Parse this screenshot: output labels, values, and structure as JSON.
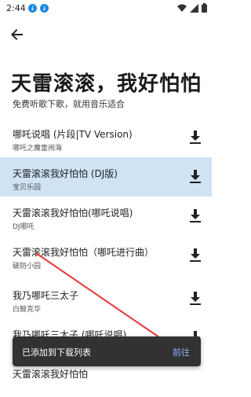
{
  "status_bar": {
    "time": "2:44",
    "icons": [
      "download-icon",
      "download-icon",
      "wifi-icon",
      "signal-icon",
      "battery-icon"
    ]
  },
  "header": {
    "back_icon": "arrow-back-icon",
    "title": "天雷滚滚，我好怕怕",
    "subtitle": "免费听歌下歌，就用音乐适合"
  },
  "songs": [
    {
      "title": "哪吒说唱 (片段|TV Version)",
      "artist": "哪吒之魔童闹海",
      "highlighted": false
    },
    {
      "title": "天雷滚滚我好怕怕 (DJ版)",
      "artist": "宝贝乐园",
      "highlighted": true
    },
    {
      "title": "天雷滚滚我好怕怕(哪吒说唱)",
      "artist": "DJ哪吒",
      "highlighted": false
    },
    {
      "title": "天雷滚滚我好怕怕（哪吒进行曲）",
      "artist": "破防小园",
      "highlighted": false
    },
    {
      "title": "我乃哪吒三太子",
      "artist": "白鲸克华",
      "highlighted": false
    },
    {
      "title": "我乃哪吒三太子 (哪吒说唱)",
      "artist": "",
      "highlighted": false
    },
    {
      "title": "天雷滚滚我好怕怕",
      "artist": "",
      "highlighted": false
    }
  ],
  "snackbar": {
    "message": "已添加到下载列表",
    "action": "前往"
  },
  "colors": {
    "highlight": "#cfe3f4",
    "snackbar_bg": "#323232",
    "snackbar_action": "#8cb4ff",
    "arrow": "#e53935"
  }
}
